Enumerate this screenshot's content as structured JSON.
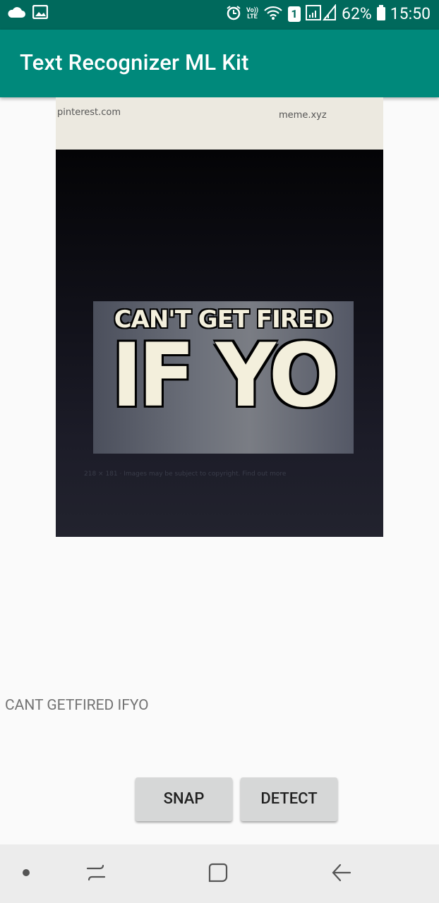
{
  "status_bar": {
    "battery": "62%",
    "time": "15:50",
    "volte_line1": "Vo))",
    "volte_line2": "LTE",
    "sim_slot": "1",
    "icons": [
      "cloud-icon",
      "image-icon",
      "alarm-icon",
      "volte-icon",
      "wifi-icon",
      "sim-icon",
      "signal-icon",
      "battery-icon"
    ]
  },
  "app_bar": {
    "title": "Text Recognizer ML Kit"
  },
  "photo": {
    "top_left_text": "pinterest.com",
    "top_right_text": "meme.xyz",
    "meme_line1": "CAN'T GET FIRED",
    "meme_line2": "IF YO",
    "caption": "218 × 181 · Images may be subject to copyright. Find out more"
  },
  "result_text": "CANT GETFIRED IFYO",
  "buttons": {
    "snap": "SNAP",
    "detect": "DETECT"
  },
  "nav_bar": {
    "icons": [
      "nav-dot-icon",
      "recents-icon",
      "home-icon",
      "back-icon"
    ]
  },
  "colors": {
    "status_bar": "#00695c",
    "app_bar": "#00897b",
    "button": "#d6d7d7"
  }
}
